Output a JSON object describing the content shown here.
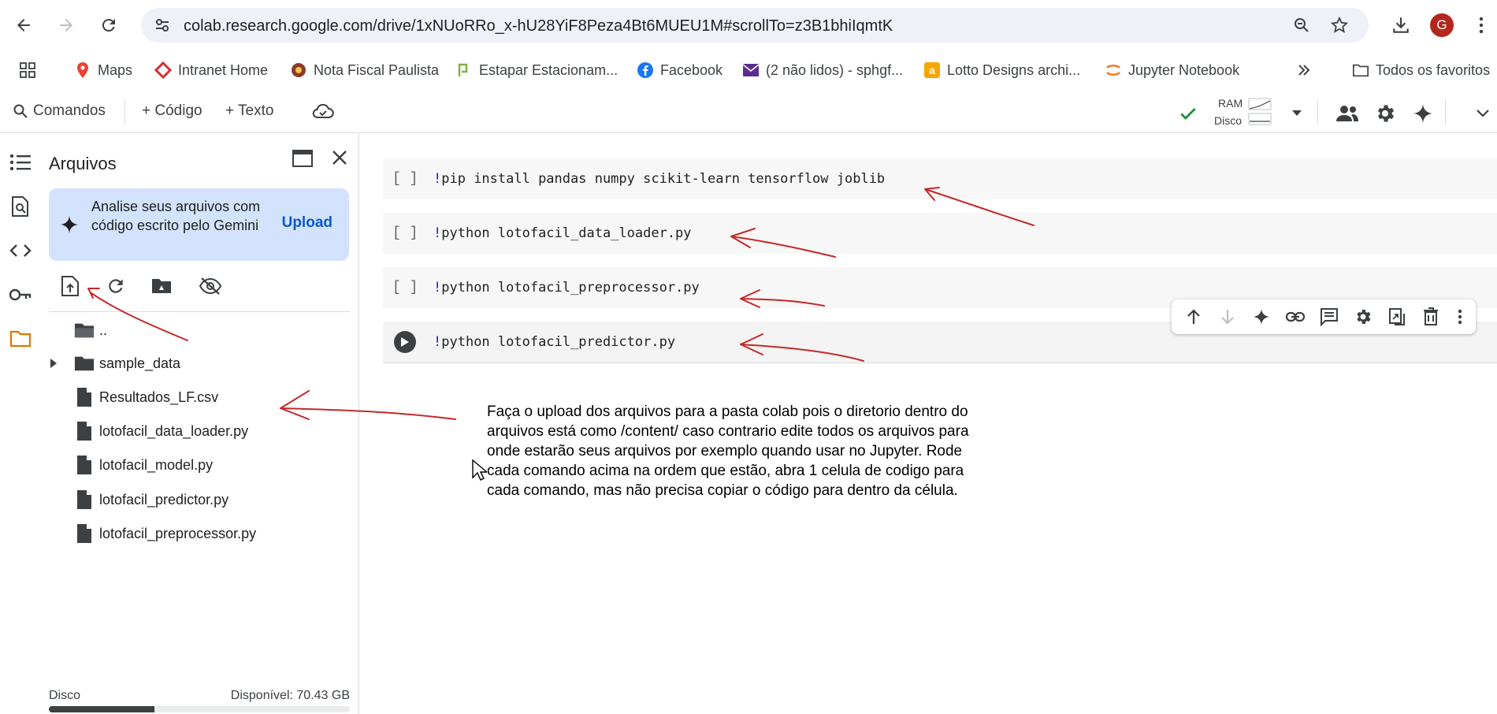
{
  "browser": {
    "url": "colab.research.google.com/drive/1xNUoRRo_x-hU28YiF8Peza4Bt6MUEU1M#scrollTo=z3B1bhiIqmtK",
    "avatar_letter": "G",
    "bookmarks": [
      {
        "label": "Maps",
        "icon": "maps-icon"
      },
      {
        "label": "Intranet Home",
        "icon": "intranet-icon"
      },
      {
        "label": "Nota Fiscal Paulista",
        "icon": "nota-fiscal-icon"
      },
      {
        "label": "Estapar Estacionam...",
        "icon": "estapar-icon"
      },
      {
        "label": "Facebook",
        "icon": "facebook-icon"
      },
      {
        "label": "(2 não lidos) - sphgf...",
        "icon": "mail-icon"
      },
      {
        "label": "Lotto Designs archi...",
        "icon": "lotto-icon"
      },
      {
        "label": "Jupyter Notebook",
        "icon": "jupyter-icon"
      }
    ],
    "all_bookmarks_label": "Todos os favoritos"
  },
  "toolbar": {
    "commands_label": "Comandos",
    "add_code_label": "+ Código",
    "add_text_label": "+ Texto",
    "ram_label": "RAM",
    "disk_label": "Disco"
  },
  "files_panel": {
    "title": "Arquivos",
    "gemini_text": "Analise seus arquivos com código escrito pelo Gemini",
    "upload_label": "Upload",
    "items": [
      {
        "name": "..",
        "type": "folder-up"
      },
      {
        "name": "sample_data",
        "type": "folder"
      },
      {
        "name": "Resultados_LF.csv",
        "type": "file"
      },
      {
        "name": "lotofacil_data_loader.py",
        "type": "file"
      },
      {
        "name": "lotofacil_model.py",
        "type": "file"
      },
      {
        "name": "lotofacil_predictor.py",
        "type": "file"
      },
      {
        "name": "lotofacil_preprocessor.py",
        "type": "file"
      }
    ],
    "disk_label": "Disco",
    "disk_available": "Disponível: 70.43 GB",
    "disk_used_fraction": 0.35
  },
  "notebook": {
    "cells": [
      {
        "prompt": "[ ]",
        "code": "pip install pandas numpy scikit-learn tensorflow joblib"
      },
      {
        "prompt": "[ ]",
        "code": "python lotofacil_data_loader.py"
      },
      {
        "prompt": "[ ]",
        "code": "python lotofacil_preprocessor.py"
      },
      {
        "prompt": "run",
        "code": "python lotofacil_predictor.py"
      }
    ],
    "bang": "!",
    "note": "Faça o upload dos arquivos para a pasta colab pois o diretorio dentro do arquivos está como /content/  caso contrario edite todos os arquivos para onde estarão seus arquivos por exemplo quando usar no Jupyter. Rode cada comando acima na ordem que estão, abra 1 celula de codigo para cada comando, mas não precisa copiar o código para dentro da célula."
  },
  "colors": {
    "accent": "#0b57d0",
    "gemini_card": "#d3e3fd",
    "annotation_red": "#c62828",
    "check_green": "#1e8e3e",
    "folder_orange": "#e37400"
  }
}
